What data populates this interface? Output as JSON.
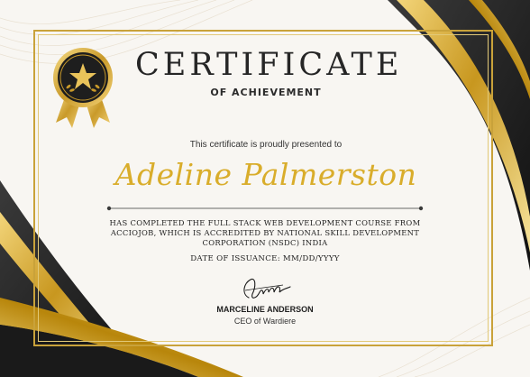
{
  "certificate": {
    "title": "CERTIFICATE",
    "subtitle": "OF ACHIEVEMENT",
    "presented_line": "This certificate is proudly presented to",
    "recipient_name": "Adeline Palmerston",
    "body": "HAS COMPLETED THE FULL STACK WEB DEVELOPMENT COURSE FROM ACCIOJOB, WHICH IS ACCREDITED BY NATIONAL SKILL DEVELOPMENT CORPORATION (NSDC) INDIA",
    "date_line": "DATE OF ISSUANCE: MM/DD/YYYY",
    "signer_name": "MARCELINE ANDERSON",
    "signer_role": "CEO of Wardiere"
  },
  "colors": {
    "gold": "#d9ad2b",
    "gold_dark": "#b8860b",
    "black_swoosh": "#1c1c1c",
    "paper": "#f8f6f2",
    "text": "#262626"
  },
  "icons": {
    "badge": "star-medal-icon",
    "laurel": "laurel-icon"
  }
}
